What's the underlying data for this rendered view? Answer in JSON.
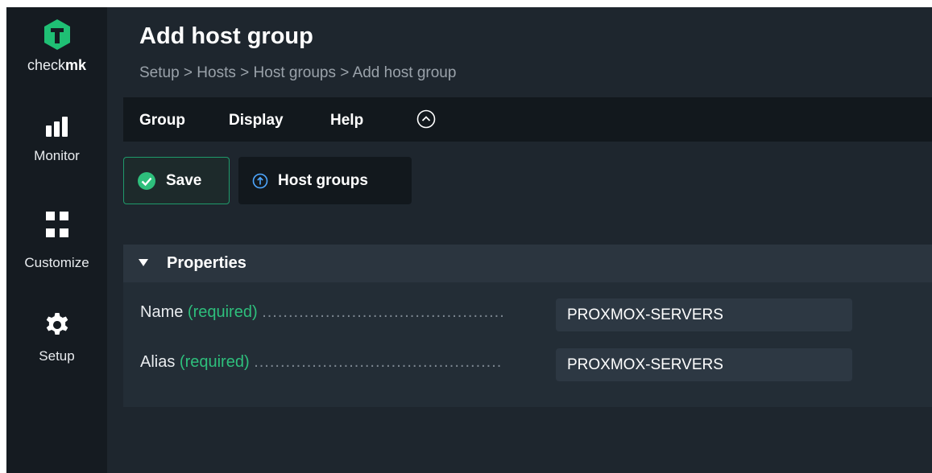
{
  "sidebar": {
    "logo": {
      "text_prefix": "check",
      "text_bold": "mk"
    },
    "items": [
      {
        "label": "Monitor",
        "icon": "bar-chart-icon"
      },
      {
        "label": "Customize",
        "icon": "grid-icon"
      },
      {
        "label": "Setup",
        "icon": "gear-icon"
      }
    ]
  },
  "header": {
    "title": "Add host group",
    "breadcrumb": "Setup > Hosts > Host groups > Add host group"
  },
  "menubar": {
    "items": [
      "Group",
      "Display",
      "Help"
    ],
    "toggle_icon": "chevron-up-circle-icon"
  },
  "toolbar": {
    "save_label": "Save",
    "host_groups_label": "Host groups"
  },
  "properties": {
    "title": "Properties",
    "fields": [
      {
        "label": "Name",
        "required": "(required)",
        "dots": "..............................................",
        "value": "PROXMOX-SERVERS"
      },
      {
        "label": "Alias",
        "required": "(required)",
        "dots": "...............................................",
        "value": "PROXMOX-SERVERS"
      }
    ]
  },
  "colors": {
    "brand_green": "#1fbf74",
    "required_green": "#2ebf7c",
    "sidebar_bg": "#151b21",
    "main_bg": "#1e262e"
  }
}
